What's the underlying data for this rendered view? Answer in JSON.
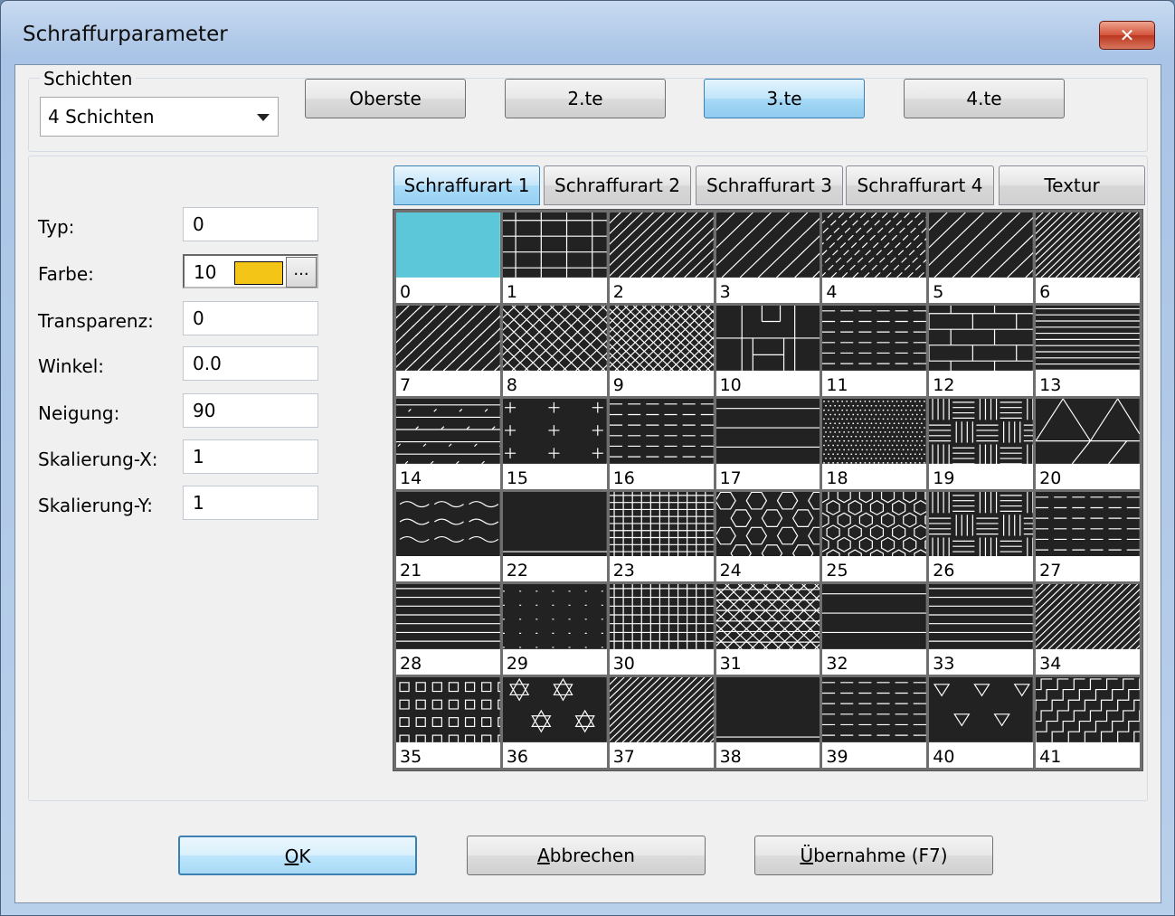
{
  "window": {
    "title": "Schraffurparameter",
    "close_label": "✕"
  },
  "layers": {
    "legend": "Schichten",
    "select_value": "4 Schichten",
    "buttons": [
      "Oberste",
      "2.te",
      "3.te",
      "4.te"
    ],
    "active_index": 2
  },
  "properties": [
    {
      "label": "Typ:",
      "value": "0"
    },
    {
      "label": "Farbe:",
      "value": "10",
      "swatch_color": "#f2c517",
      "picker_label": "..."
    },
    {
      "label": "Transparenz:",
      "value": "0"
    },
    {
      "label": "Winkel:",
      "value": "0.0"
    },
    {
      "label": "Neigung:",
      "value": "90"
    },
    {
      "label": "Skalierung-X:",
      "value": "1"
    },
    {
      "label": "Skalierung-Y:",
      "value": "1"
    }
  ],
  "tabs": {
    "items": [
      "Schraffurart 1",
      "Schraffurart 2",
      "Schraffurart 3",
      "Schraffurart 4",
      "Textur"
    ],
    "active_index": 0
  },
  "patterns": {
    "selected_index": 0,
    "selected_color": "#5bc7d9",
    "items": [
      {
        "n": "0",
        "p": "none"
      },
      {
        "n": "1",
        "p": "grid"
      },
      {
        "n": "2",
        "p": "diag"
      },
      {
        "n": "3",
        "p": "diag-wide"
      },
      {
        "n": "4",
        "p": "diag-dash"
      },
      {
        "n": "5",
        "p": "diag-wide"
      },
      {
        "n": "6",
        "p": "diag-dense"
      },
      {
        "n": "7",
        "p": "diag-double"
      },
      {
        "n": "8",
        "p": "cross"
      },
      {
        "n": "9",
        "p": "cross-dense"
      },
      {
        "n": "10",
        "p": "blocks"
      },
      {
        "n": "11",
        "p": "hdash"
      },
      {
        "n": "12",
        "p": "brick"
      },
      {
        "n": "13",
        "p": "hlines-dense"
      },
      {
        "n": "14",
        "p": "hatch-mix"
      },
      {
        "n": "15",
        "p": "plus"
      },
      {
        "n": "16",
        "p": "hdash"
      },
      {
        "n": "17",
        "p": "hlines-wide"
      },
      {
        "n": "18",
        "p": "dots"
      },
      {
        "n": "19",
        "p": "weave"
      },
      {
        "n": "20",
        "p": "triangles"
      },
      {
        "n": "21",
        "p": "waves"
      },
      {
        "n": "22",
        "p": "solid"
      },
      {
        "n": "23",
        "p": "grid-dense"
      },
      {
        "n": "24",
        "p": "hex"
      },
      {
        "n": "25",
        "p": "hex-dense"
      },
      {
        "n": "26",
        "p": "weave"
      },
      {
        "n": "27",
        "p": "hdash"
      },
      {
        "n": "28",
        "p": "hlines"
      },
      {
        "n": "29",
        "p": "hdots"
      },
      {
        "n": "30",
        "p": "grid-fine"
      },
      {
        "n": "31",
        "p": "tri-grid"
      },
      {
        "n": "32",
        "p": "hlines-wide"
      },
      {
        "n": "33",
        "p": "hlines"
      },
      {
        "n": "34",
        "p": "diag-dense"
      },
      {
        "n": "35",
        "p": "squares"
      },
      {
        "n": "36",
        "p": "stars"
      },
      {
        "n": "37",
        "p": "diag-dense"
      },
      {
        "n": "38",
        "p": "solid"
      },
      {
        "n": "39",
        "p": "hdash"
      },
      {
        "n": "40",
        "p": "tri-down"
      },
      {
        "n": "41",
        "p": "steps"
      }
    ]
  },
  "dialog_buttons": {
    "ok": {
      "accel": "O",
      "rest": "K"
    },
    "cancel": {
      "accel": "A",
      "rest": "bbrechen"
    },
    "apply": {
      "accel": "Ü",
      "rest": "bernahme (F7)"
    }
  }
}
